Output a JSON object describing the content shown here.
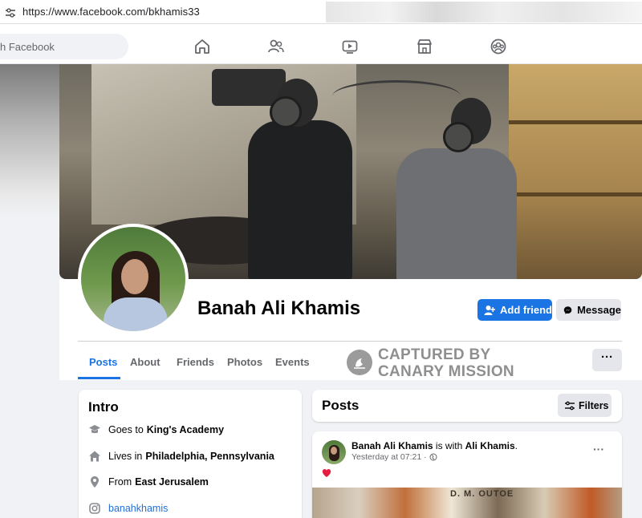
{
  "browser": {
    "url": "https://www.facebook.com/bkhamis33"
  },
  "fbnav": {
    "search_placeholder": "h Facebook",
    "icons": [
      "home-icon",
      "friends-icon",
      "watch-icon",
      "marketplace-icon",
      "groups-icon"
    ]
  },
  "profile": {
    "name": "Banah Ali Khamis",
    "add_friend_label": "Add friend",
    "message_label": "Message"
  },
  "tabs": [
    {
      "label": "Posts",
      "active": true
    },
    {
      "label": "About",
      "active": false
    },
    {
      "label": "Friends",
      "active": false
    },
    {
      "label": "Photos",
      "active": false
    },
    {
      "label": "Events",
      "active": false
    }
  ],
  "more_label": "···",
  "watermark": {
    "line1": "CAPTURED BY",
    "line2": "CANARY MISSION"
  },
  "intro": {
    "title": "Intro",
    "rows": [
      {
        "icon": "school-icon",
        "prefix": "Goes to",
        "value": "King's Academy"
      },
      {
        "icon": "home-icon",
        "prefix": "Lives in",
        "value": "Philadelphia, Pennsylvania"
      },
      {
        "icon": "location-icon",
        "prefix": "From",
        "value": "East Jerusalem"
      },
      {
        "icon": "instagram-icon",
        "prefix": "",
        "value": "banahkhamis"
      }
    ]
  },
  "posts_section": {
    "title": "Posts",
    "filters_label": "Filters"
  },
  "post": {
    "author": "Banah Ali Khamis",
    "with_text": "is with",
    "tagged": "Ali Khamis",
    "tagged_suffix": ".",
    "time": "Yesterday at 07:21 ·",
    "dots": "···",
    "image_sign": "D. M. OUTOE"
  },
  "colors": {
    "fb_blue": "#1b74e4",
    "background": "#f0f2f5",
    "link": "#216fdb"
  }
}
